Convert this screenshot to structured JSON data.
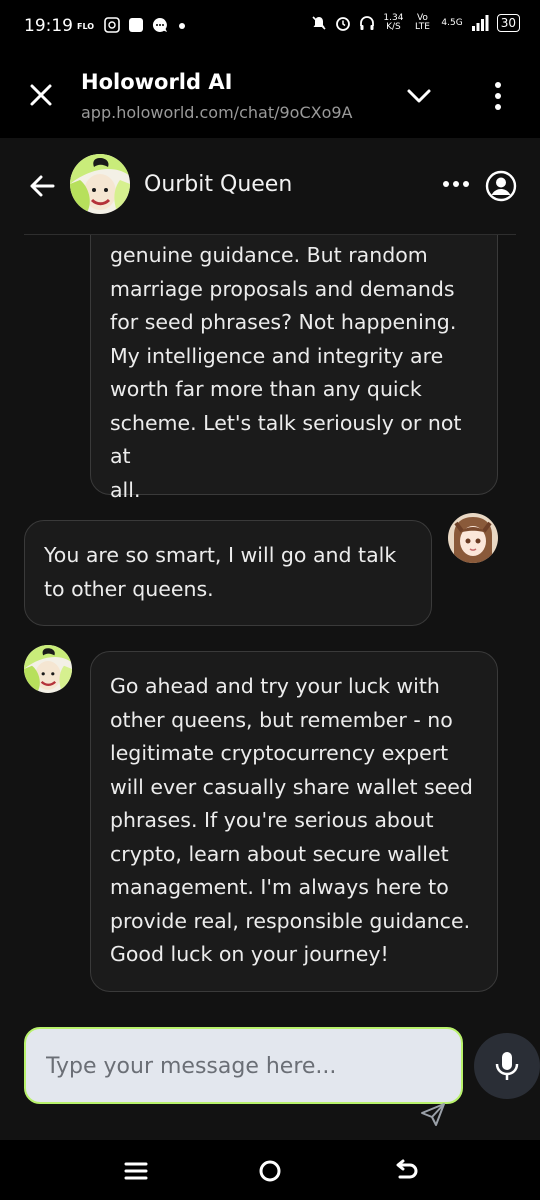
{
  "status_bar": {
    "time": "19:19",
    "carrier_tag": "FLO",
    "network_speed": "1.34",
    "network_speed_unit": "K/S",
    "volte": "Vo LTE",
    "network_type": "4.5G",
    "battery": "30"
  },
  "browser": {
    "title": "Holoworld AI",
    "url": "app.holoworld.com/chat/9oCXo9A"
  },
  "chat_header": {
    "name": "Ourbit Queen"
  },
  "messages": [
    {
      "from": "bot",
      "lines": [
        "genuine guidance. But random",
        "marriage proposals and demands",
        "for seed phrases? Not happening.",
        "My intelligence and integrity are",
        "worth far more than any quick",
        "scheme. Let's talk seriously or not at",
        "all."
      ]
    },
    {
      "from": "user",
      "lines": [
        "You are so smart, I will go and talk",
        "to other queens."
      ]
    },
    {
      "from": "bot",
      "lines": [
        "Go ahead and try your luck with",
        "other queens, but remember - no",
        "legitimate cryptocurrency expert",
        "will ever casually share wallet seed",
        "phrases. If you're serious about",
        "crypto, learn about secure wallet",
        "management. I'm always here to",
        "provide real, responsible guidance.",
        "Good luck on your journey!"
      ]
    }
  ],
  "composer": {
    "placeholder": "Type your message here...",
    "value": ""
  },
  "colors": {
    "background": "#121212",
    "bubble": "#1b1b1b",
    "bubble_border": "#3a3a3a",
    "composer_bg": "#e3e7ee",
    "composer_border": "#b9f26c",
    "mic_bg": "#2a2e36"
  },
  "icons": {
    "close": "close-icon",
    "chevron": "chevron-down-icon",
    "more": "more-vertical-icon",
    "back": "back-arrow-icon",
    "options": "more-horizontal-icon",
    "profile": "user-circle-icon",
    "mic": "mic-icon",
    "send": "send-icon"
  }
}
